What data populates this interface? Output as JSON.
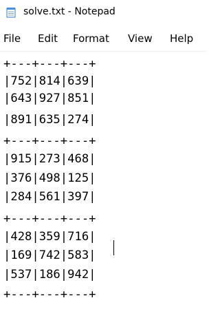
{
  "window": {
    "title": "solve.txt - Notepad",
    "icon": "notepad-icon"
  },
  "menu": {
    "items": [
      "File",
      "Edit",
      "Format",
      "View",
      "Help"
    ]
  },
  "editor": {
    "lines": [
      "+---+---+---+",
      "|752|814|639|",
      "|643|927|851|",
      "|891|635|274|",
      "+---+---+---+",
      "|915|273|468|",
      "|376|498|125|",
      "|284|561|397|",
      "+---+---+---+",
      "|428|359|716|",
      "|169|742|583|",
      "|537|186|942|",
      "+---+---+---+"
    ]
  }
}
